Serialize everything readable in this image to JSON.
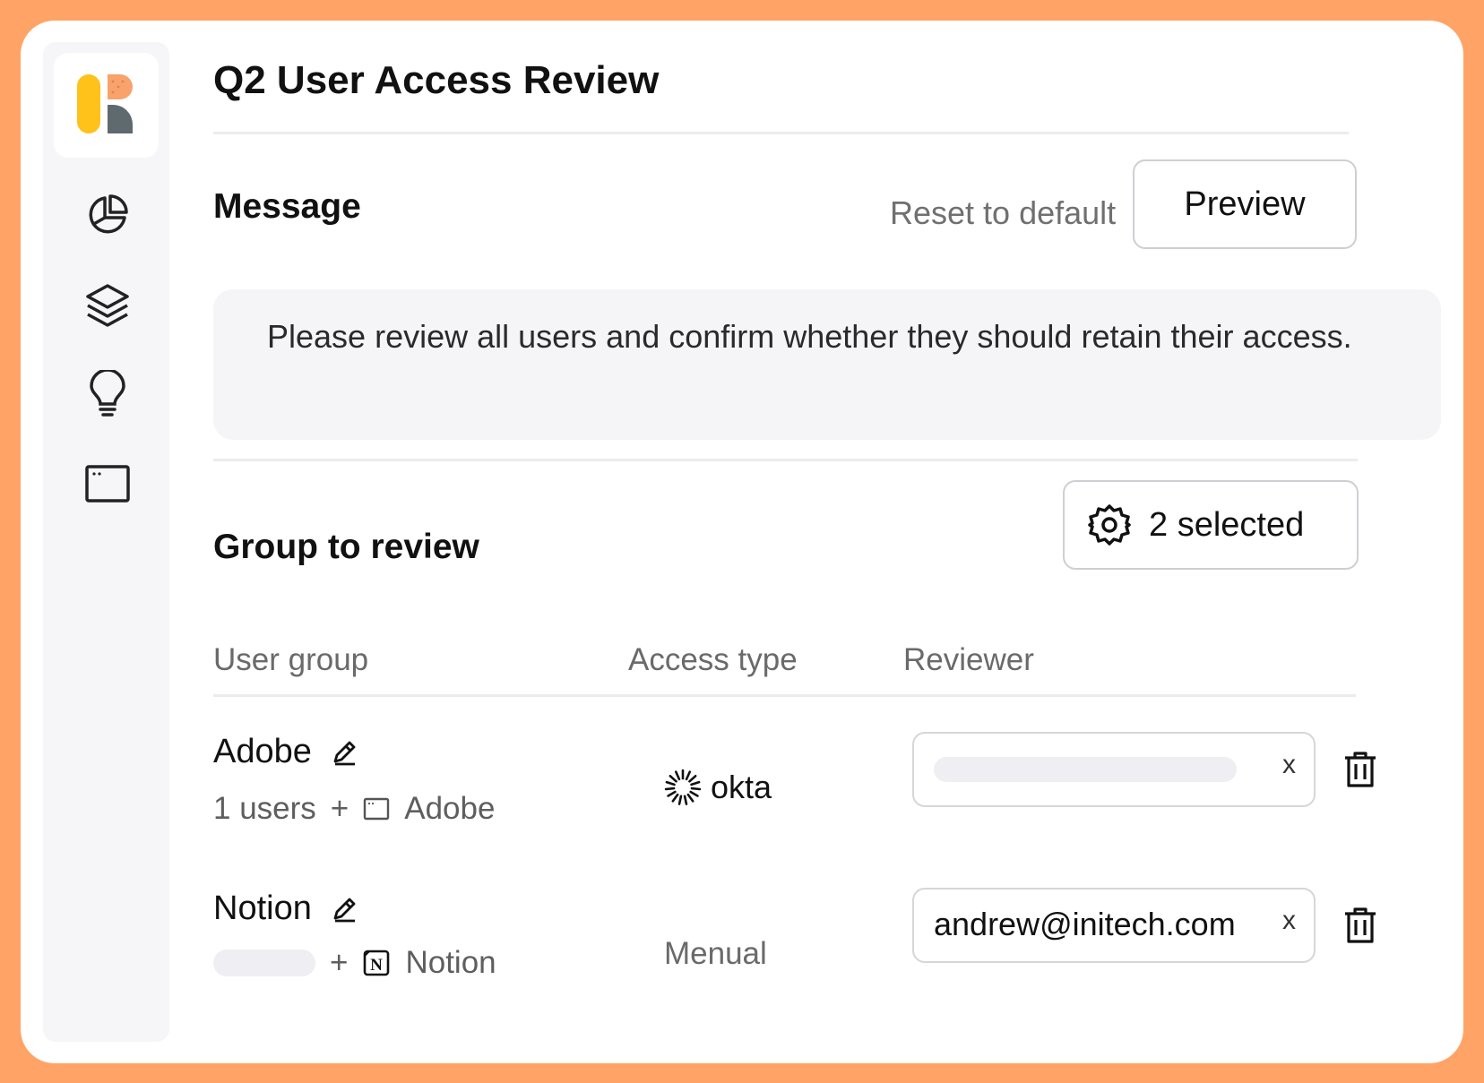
{
  "page": {
    "title": "Q2 User Access Review"
  },
  "sidebar": {
    "logo": "brand-logo",
    "items": [
      {
        "icon": "pie-chart-icon"
      },
      {
        "icon": "layers-icon"
      },
      {
        "icon": "lightbulb-icon"
      },
      {
        "icon": "browser-window-icon"
      }
    ]
  },
  "message_section": {
    "title": "Message",
    "reset_label": "Reset to default",
    "preview_label": "Preview",
    "text": "Please review all users and confirm whether they should retain their access."
  },
  "group_section": {
    "title": "Group to review",
    "selected_label": "2 selected",
    "columns": {
      "user_group": "User group",
      "access_type": "Access type",
      "reviewer": "Reviewer"
    },
    "rows": [
      {
        "name": "Adobe",
        "users_label": "1 users",
        "plus": "+",
        "app_name": "Adobe",
        "access_type": "okta",
        "reviewer": ""
      },
      {
        "name": "Notion",
        "users_label": "",
        "plus": "+",
        "app_name": "Notion",
        "access_type": "Menual",
        "reviewer": "andrew@initech.com"
      }
    ],
    "clear_symbol": "x"
  },
  "colors": {
    "frame": "#FFA466",
    "logo_yellow": "#FFC21A",
    "logo_orange": "#F7A36B",
    "logo_gray": "#5F6A6E"
  }
}
